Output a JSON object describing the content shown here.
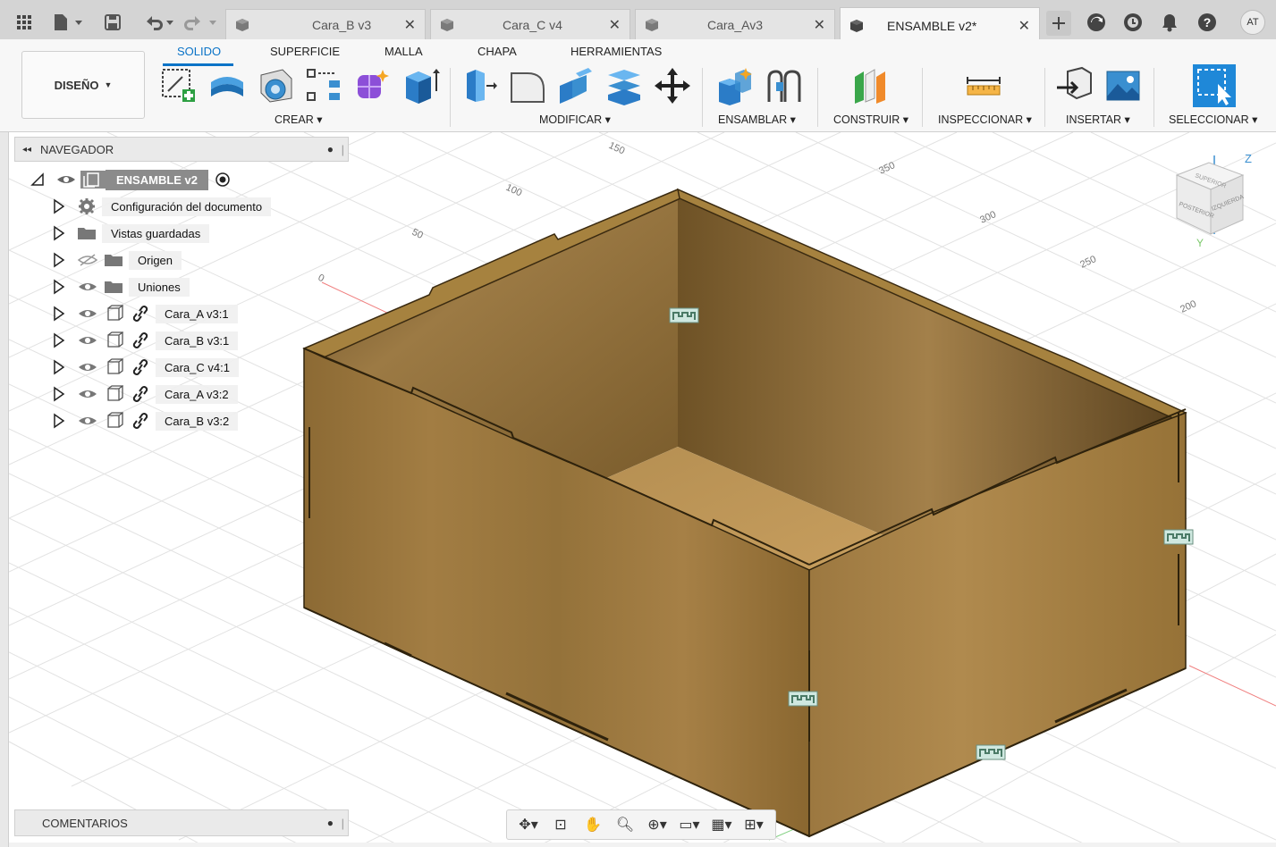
{
  "tabs": [
    {
      "label": "Cara_B v3",
      "active": false
    },
    {
      "label": "Cara_C v4",
      "active": false
    },
    {
      "label": "Cara_Av3",
      "active": false
    },
    {
      "label": "ENSAMBLE v2*",
      "active": true
    }
  ],
  "user_initials": "AT",
  "workspace": {
    "label": "DISEÑO"
  },
  "ribbon_tabs": [
    "SOLIDO",
    "SUPERFICIE",
    "MALLA",
    "CHAPA",
    "HERRAMIENTAS"
  ],
  "groups": {
    "crear": "CREAR",
    "modificar": "MODIFICAR",
    "ensamblar": "ENSAMBLAR",
    "construir": "CONSTRUIR",
    "inspeccionar": "INSPECCIONAR",
    "insertar": "INSERTAR",
    "seleccionar": "SELECCIONAR"
  },
  "navigator": {
    "title": "NAVEGADOR",
    "root": "ENSAMBLE v2",
    "items": [
      {
        "label": "Configuración del documento",
        "type": "settings"
      },
      {
        "label": "Vistas guardadas",
        "type": "folder"
      },
      {
        "label": "Origen",
        "type": "folder",
        "hidden": true
      },
      {
        "label": "Uniones",
        "type": "folder"
      },
      {
        "label": "Cara_A v3:1",
        "type": "component"
      },
      {
        "label": "Cara_B v3:1",
        "type": "component"
      },
      {
        "label": "Cara_C v4:1",
        "type": "component"
      },
      {
        "label": "Cara_A v3:2",
        "type": "component"
      },
      {
        "label": "Cara_B v3:2",
        "type": "component"
      }
    ]
  },
  "comments": {
    "title": "COMENTARIOS"
  },
  "grid_labels": [
    "150",
    "100",
    "50",
    "0",
    "350",
    "300",
    "250",
    "200"
  ],
  "viewcube": {
    "top": "SUPERIOR",
    "front": "POSTERIOR",
    "side": "IZQUIERDA",
    "axis_z": "Z",
    "axis_y": "Y"
  },
  "colors": {
    "accent": "#0a73c7",
    "wood": "#8a6a35",
    "axis_red": "#e05050",
    "axis_green": "#50c050"
  }
}
